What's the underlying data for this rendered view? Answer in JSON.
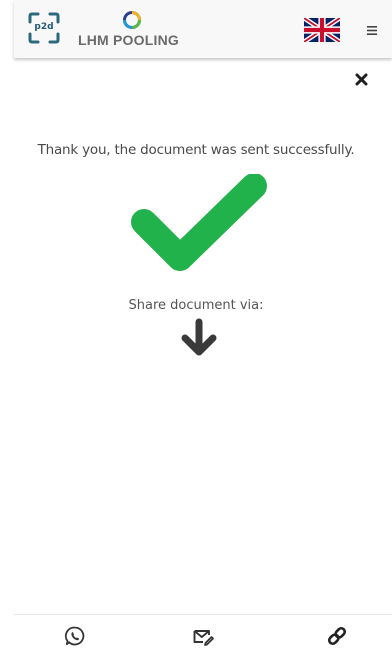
{
  "header": {
    "logo_text": "p2d",
    "brand_name": "LHM POOLING",
    "language_flag_icon": "uk-flag-icon",
    "menu_icon": "hamburger-menu-icon"
  },
  "dialog": {
    "close_icon": "close-icon",
    "message": "Thank you, the document was sent successfully.",
    "success_icon": "checkmark-icon",
    "share_label": "Share document via:",
    "arrow_icon": "arrow-down-icon"
  },
  "footer": {
    "items": [
      {
        "icon": "whatsapp-icon"
      },
      {
        "icon": "email-edit-icon"
      },
      {
        "icon": "link-icon"
      }
    ]
  },
  "colors": {
    "success_green": "#22b24c",
    "icon_dark": "#333333",
    "brand_teal": "#1f5a72",
    "brand_gray": "#6b6b6b"
  }
}
